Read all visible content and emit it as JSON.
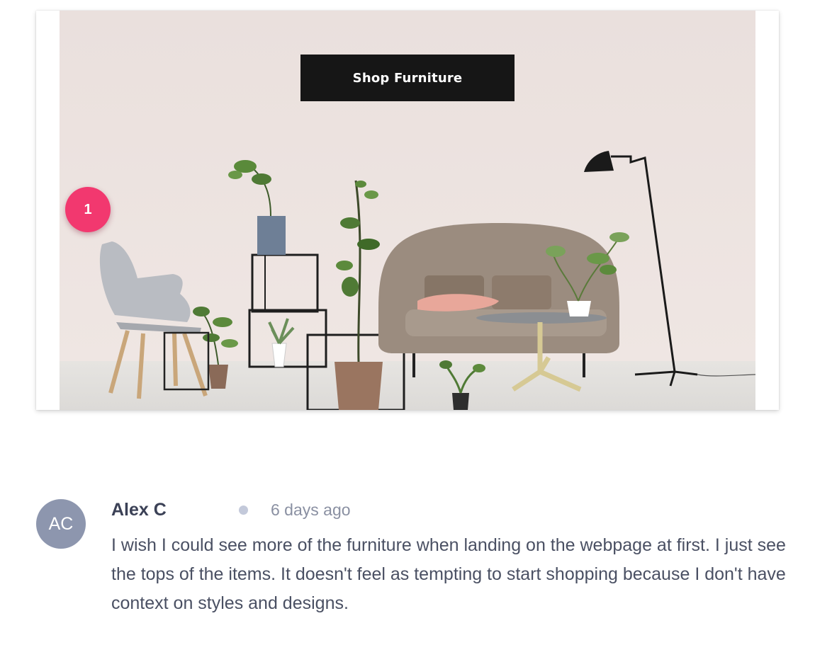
{
  "hero": {
    "cta_label": "Shop Furniture",
    "annotation_number": "1",
    "colors": {
      "wall": "#ece2df",
      "floor": "#e3e1de",
      "cta_bg": "#161616",
      "marker": "#f2386f"
    }
  },
  "comment": {
    "avatar_initials": "AC",
    "author": "Alex C",
    "time": "6 days ago",
    "body": "I wish I could see more of the furniture when landing on the webpage at first. I just see the tops of the items. It doesn't feel as tempting to start shopping because I don't have context on styles and designs."
  }
}
